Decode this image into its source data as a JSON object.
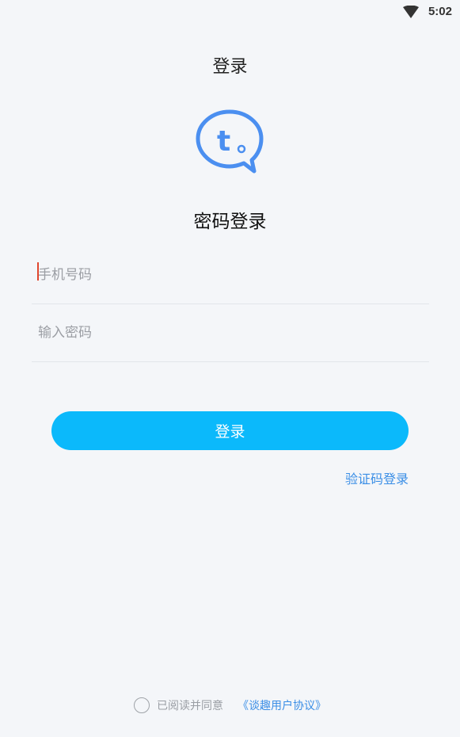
{
  "status_bar": {
    "time": "5:02",
    "wifi_icon": "wifi-icon"
  },
  "header": {
    "title": "登录"
  },
  "logo": {
    "icon": "chat-bubble-logo",
    "letter": "t",
    "brand_color": "#4b8ff0"
  },
  "form": {
    "heading": "密码登录",
    "phone_placeholder": "手机号码",
    "phone_value": "",
    "password_placeholder": "输入密码",
    "password_value": "",
    "login_button": "登录",
    "sms_login_link": "验证码登录"
  },
  "agreement": {
    "checked": false,
    "text": "已阅读并同意",
    "link": "《谈趣用户协议》"
  },
  "colors": {
    "background": "#f4f6f9",
    "primary_button": "#0bb9fb",
    "link": "#3a8ee6",
    "placeholder": "#9b9ea4",
    "cursor": "#e0462e"
  }
}
